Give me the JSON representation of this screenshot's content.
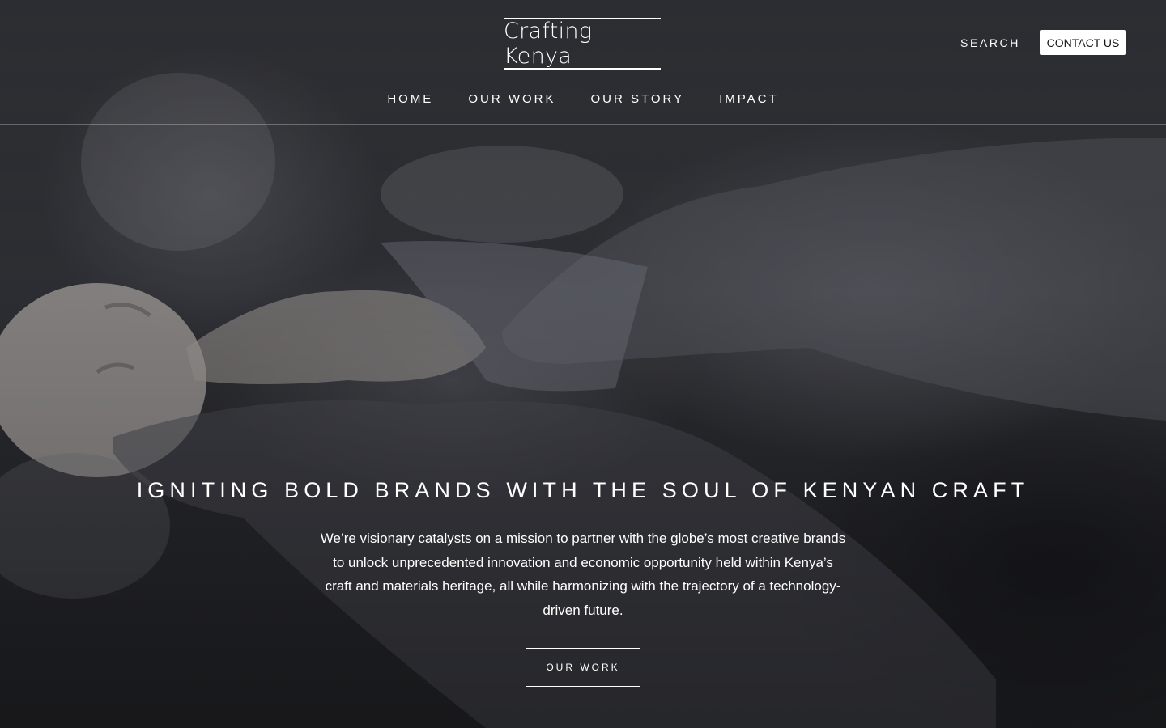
{
  "header": {
    "logo_text": "Crafting Kenya",
    "search_label": "SEARCH",
    "contact_label": "CONTACT US"
  },
  "nav": {
    "items": [
      {
        "label": "HOME"
      },
      {
        "label": "OUR WORK"
      },
      {
        "label": "OUR STORY"
      },
      {
        "label": "IMPACT"
      }
    ]
  },
  "hero": {
    "title": "IGNITING BOLD BRANDS WITH THE SOUL OF KENYAN CRAFT",
    "text": "We’re visionary catalysts on a mission to partner with the globe’s most creative brands to unlock unprecedented innovation and economic opportunity held within Kenya’s craft and materials heritage, all while harmonizing with the trajectory of a technology-driven future.",
    "cta_label": "OUR WORK",
    "background_image": "artisan-hands-sanding-carved-figure"
  }
}
